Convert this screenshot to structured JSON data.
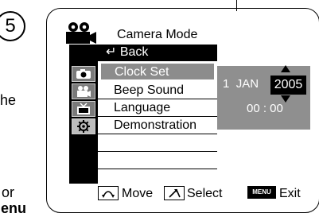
{
  "step_number": "5",
  "left_fragments": {
    "the": "he",
    "or": "or",
    "menu": "lenu"
  },
  "menu": {
    "title": "Camera Mode",
    "back_label": "↵ Back",
    "items": [
      "Clock Set",
      "Beep Sound",
      "Language",
      "Demonstration",
      "",
      ""
    ],
    "selected_index": 0,
    "side_icons": [
      "camera-mode-icon",
      "movie-camera-icon",
      "tv-icon",
      "gear-icon"
    ]
  },
  "clock": {
    "day": "1",
    "month": "JAN",
    "year": "2005",
    "time": "00 : 00"
  },
  "bottom_bar": {
    "move_label": "Move",
    "select_label": "Select",
    "menu_button_text": "MENU",
    "exit_label": "Exit"
  }
}
